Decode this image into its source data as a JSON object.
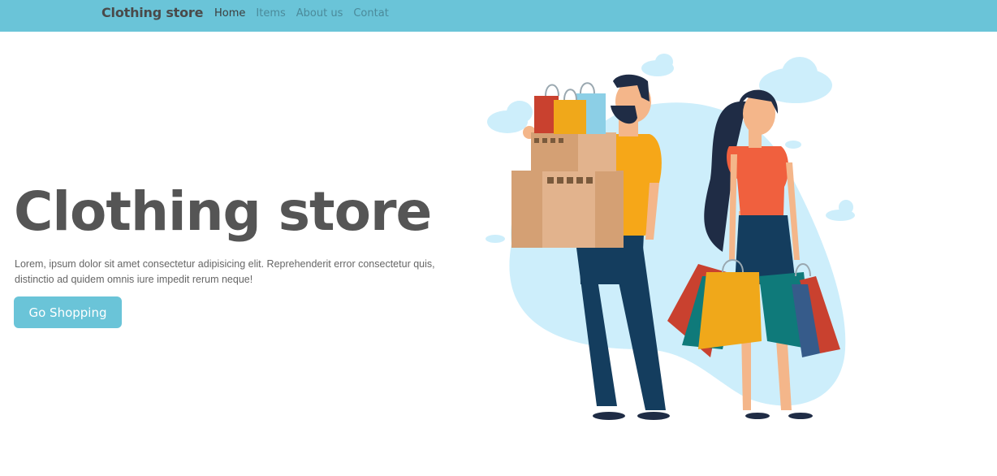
{
  "nav": {
    "brand": "Clothing store",
    "links": [
      {
        "label": "Home",
        "active": true
      },
      {
        "label": "Items",
        "active": false
      },
      {
        "label": "About us",
        "active": false
      },
      {
        "label": "Contat",
        "active": false
      }
    ]
  },
  "hero": {
    "title": "Clothing store",
    "text": "Lorem, ipsum dolor sit amet consectetur adipisicing elit. Reprehenderit error consectetur quis, distinctio ad quidem omnis iure impedit rerum neque!",
    "button_label": "Go Shopping"
  },
  "colors": {
    "navbar": "#6ac4d8",
    "button": "#6ac4d8",
    "title": "#555555"
  }
}
